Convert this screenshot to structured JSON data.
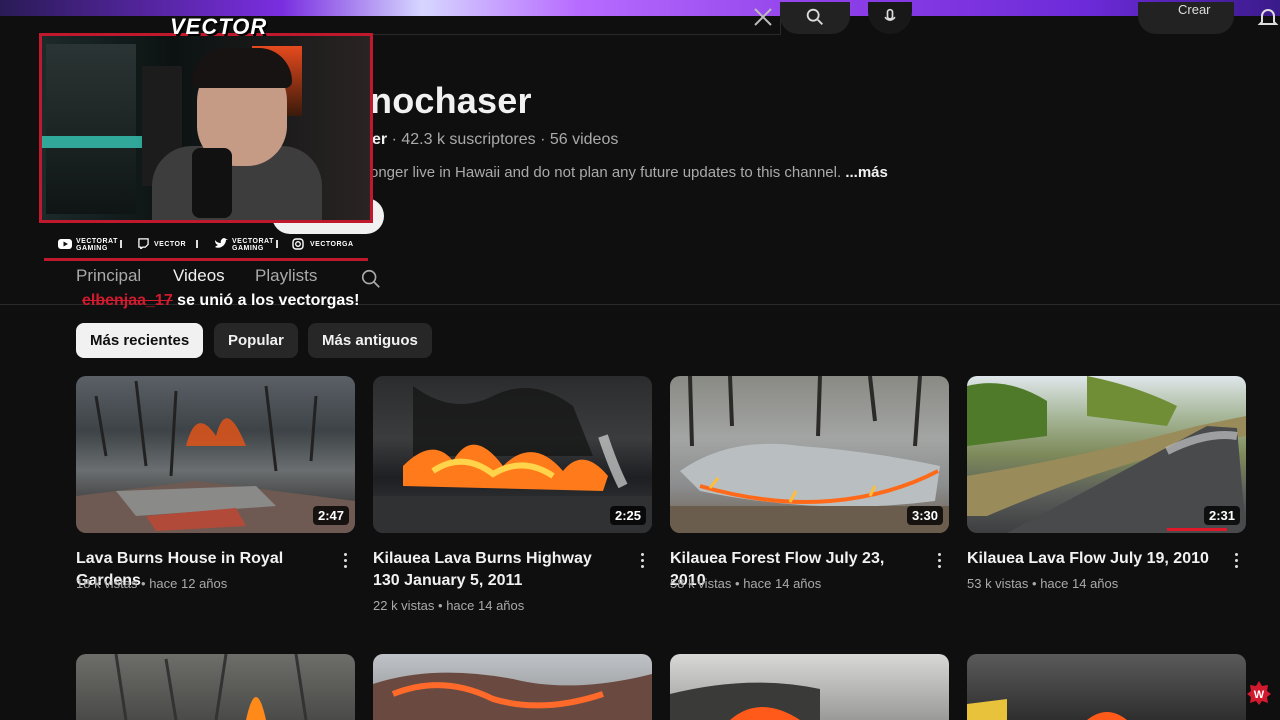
{
  "channel": {
    "title_partial": "nochaser",
    "handle_partial": "er",
    "meta": "· 42.3 k suscriptores · 56 videos",
    "description": "onger live in Hawaii and do not plan any future updates to this channel.",
    "more_label": "...más"
  },
  "topbar": {
    "create_label": "Crear"
  },
  "overlay": {
    "logo": "VECTOR",
    "socials": [
      {
        "icon": "youtube-icon",
        "line1": "VECTORAT",
        "line2": "GAMING"
      },
      {
        "icon": "twitch-icon",
        "line1": "VECTOR",
        "line2": ""
      },
      {
        "icon": "twitter-icon",
        "line1": "VECTORAT",
        "line2": "GAMING"
      },
      {
        "icon": "instagram-icon",
        "line1": "VECTORGA",
        "line2": ""
      }
    ],
    "chat_user": "elbenjaa_17",
    "chat_message": " se unió a los vectorgas!"
  },
  "tabs": [
    {
      "label": "Principal",
      "active": false
    },
    {
      "label": "Videos",
      "active": true
    },
    {
      "label": "Playlists",
      "active": false
    }
  ],
  "chips": [
    {
      "label": "Más recientes",
      "active": true
    },
    {
      "label": "Popular",
      "active": false
    },
    {
      "label": "Más antiguos",
      "active": false
    }
  ],
  "videos": [
    {
      "title": "Lava Burns House in Royal Gardens",
      "views": "18 k vistas",
      "age": "hace 12 años",
      "duration": "2:47"
    },
    {
      "title": "Kilauea Lava Burns Highway 130 January 5, 2011",
      "views": "22 k vistas",
      "age": "hace 14 años",
      "duration": "2:25"
    },
    {
      "title": "Kilauea Forest Flow July 23, 2010",
      "views": "58 k vistas",
      "age": "hace 14 años",
      "duration": "3:30"
    },
    {
      "title": "Kilauea Lava Flow July 19, 2010",
      "views": "53 k vistas",
      "age": "hace 14 años",
      "duration": "2:31"
    }
  ],
  "colors": {
    "accent_red": "#c0182c",
    "background": "#0f0f0f",
    "muted_text": "#aaaaaa"
  },
  "badge": {
    "letter": "W"
  }
}
